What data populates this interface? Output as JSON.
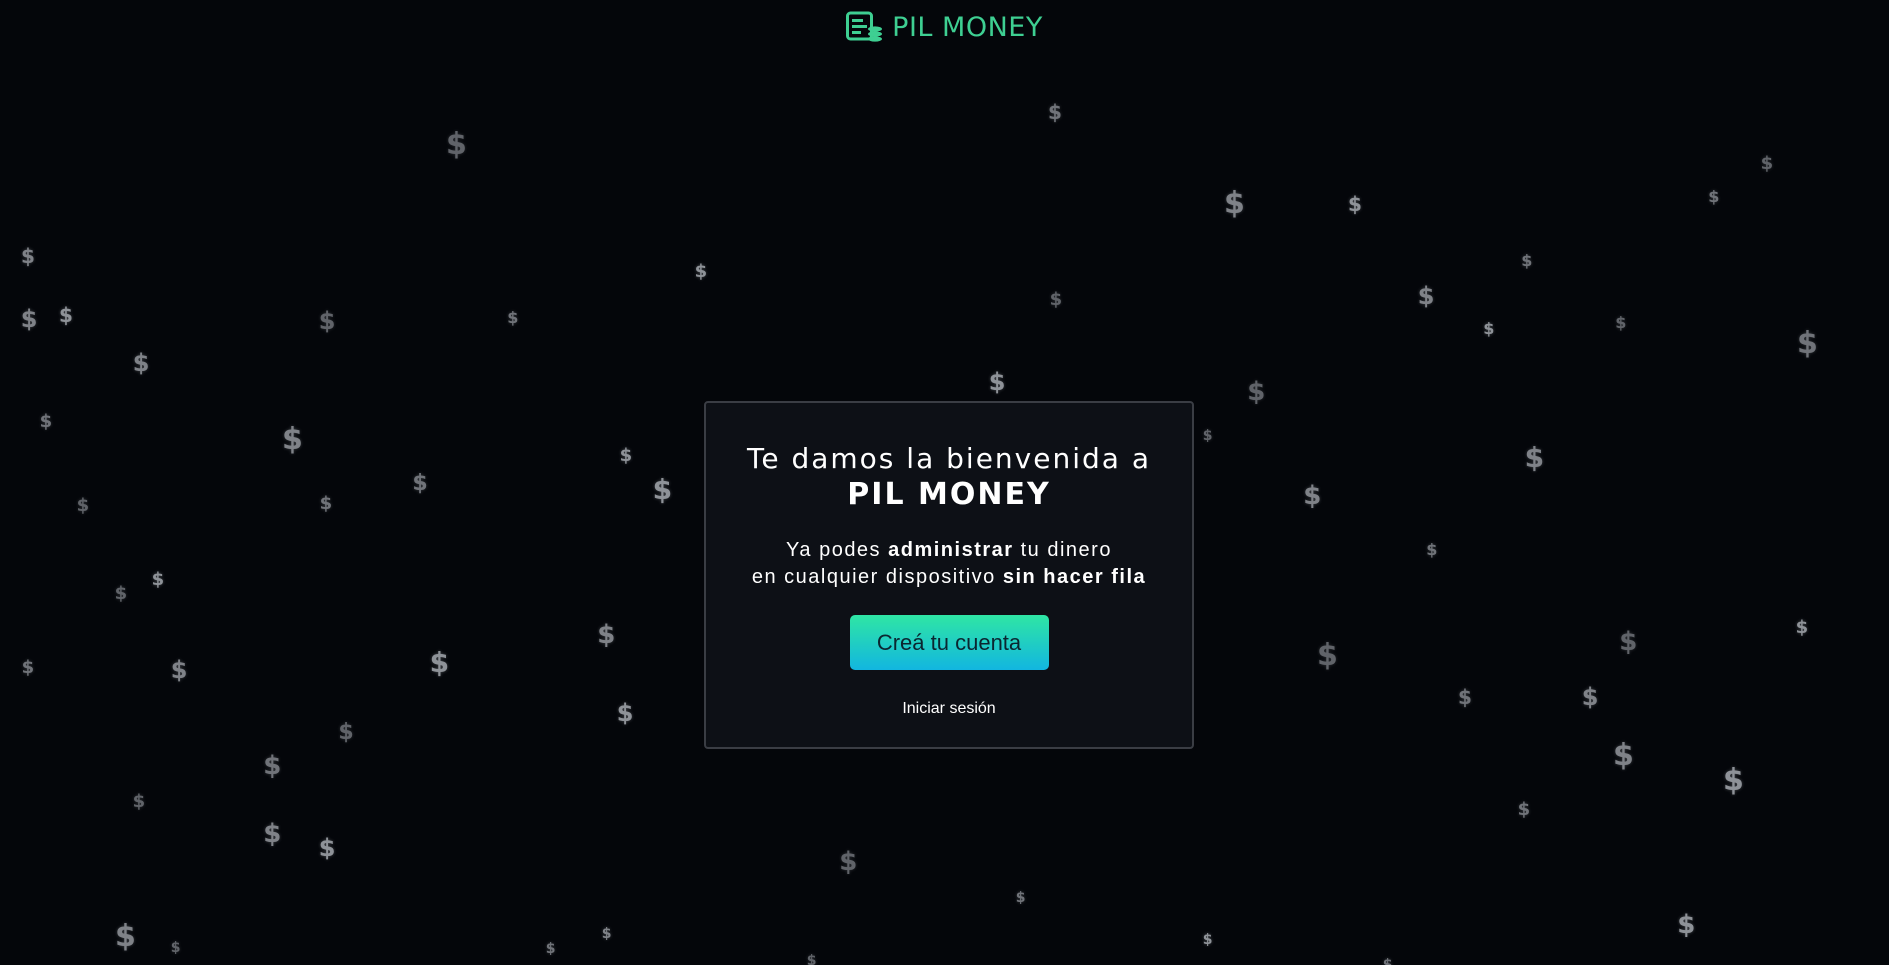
{
  "header": {
    "logo_icon": "money-stack-icon",
    "brand_name": "PIL MONEY",
    "brand_color": "#3ecf92"
  },
  "background": {
    "symbol": "$",
    "color": "#04060a",
    "symbol_color": "#9ea2a8"
  },
  "modal": {
    "welcome_text": "Te damos la bienvenida a",
    "brand_name": "PIL MONEY",
    "line1_pre": "Ya podes ",
    "line1_bold": "administrar",
    "line1_post": " tu dinero",
    "line2_pre": "en cualquier dispositivo ",
    "line2_bold": "sin hacer fila",
    "cta_label": "Creá tu cuenta",
    "cta_gradient": [
      "#2fe6a4",
      "#12b6e0"
    ],
    "login_label": "Iniciar sesión"
  }
}
